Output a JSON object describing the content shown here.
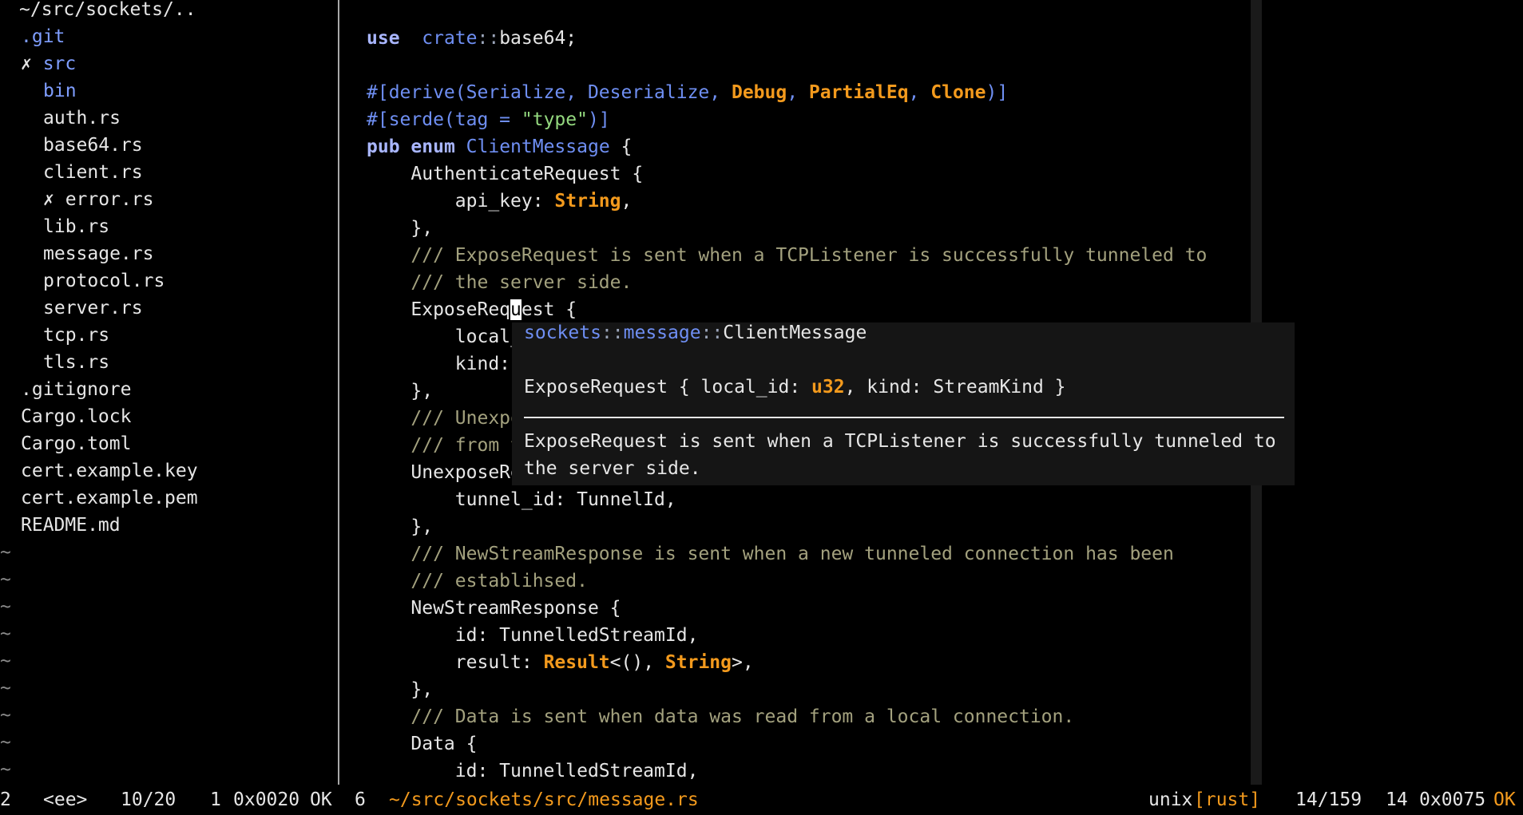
{
  "file_tree": {
    "header": "~/src/sockets/..",
    "items": [
      {
        "prefix": "",
        "name": ".git",
        "kind": "dir",
        "indent": 1
      },
      {
        "prefix": "✗ ",
        "name": "src",
        "kind": "dir",
        "indent": 1
      },
      {
        "prefix": "",
        "name": "bin",
        "kind": "dir",
        "indent": 2
      },
      {
        "prefix": "",
        "name": "auth.rs",
        "kind": "file",
        "indent": 2
      },
      {
        "prefix": "",
        "name": "base64.rs",
        "kind": "file",
        "indent": 2
      },
      {
        "prefix": "",
        "name": "client.rs",
        "kind": "file",
        "indent": 2
      },
      {
        "prefix": "✗ ",
        "name": "error.rs",
        "kind": "file",
        "indent": 2
      },
      {
        "prefix": "",
        "name": "lib.rs",
        "kind": "file",
        "indent": 2
      },
      {
        "prefix": "",
        "name": "message.rs",
        "kind": "file",
        "indent": 2
      },
      {
        "prefix": "",
        "name": "protocol.rs",
        "kind": "file",
        "indent": 2
      },
      {
        "prefix": "",
        "name": "server.rs",
        "kind": "file",
        "indent": 2
      },
      {
        "prefix": "",
        "name": "tcp.rs",
        "kind": "file",
        "indent": 2
      },
      {
        "prefix": "",
        "name": "tls.rs",
        "kind": "file",
        "indent": 2
      },
      {
        "prefix": "",
        "name": ".gitignore",
        "kind": "file",
        "indent": 0
      },
      {
        "prefix": "",
        "name": "Cargo.lock",
        "kind": "file",
        "indent": 0
      },
      {
        "prefix": "",
        "name": "Cargo.toml",
        "kind": "file",
        "indent": 0
      },
      {
        "prefix": "",
        "name": "cert.example.key",
        "kind": "file",
        "indent": 0
      },
      {
        "prefix": "",
        "name": "cert.example.pem",
        "kind": "file",
        "indent": 0
      },
      {
        "prefix": "",
        "name": "README.md",
        "kind": "file",
        "indent": 0
      }
    ],
    "empty_marker": "~"
  },
  "editor": {
    "lines": [
      [
        [
          "k",
          "use"
        ],
        [
          "",
          "  "
        ],
        [
          "b",
          "crate"
        ],
        [
          "p",
          "::"
        ],
        [
          "",
          "base64;"
        ]
      ],
      [],
      [
        [
          "b",
          "#[derive(Serialize, Deserialize, "
        ],
        [
          "t",
          "Debug"
        ],
        [
          "b",
          ", "
        ],
        [
          "t",
          "PartialEq"
        ],
        [
          "b",
          ", "
        ],
        [
          "t",
          "Clone"
        ],
        [
          "b",
          ")]"
        ]
      ],
      [
        [
          "b",
          "#[serde(tag = "
        ],
        [
          "s",
          "\"type\""
        ],
        [
          "b",
          ")]"
        ]
      ],
      [
        [
          "k",
          "pub"
        ],
        [
          "",
          " "
        ],
        [
          "k",
          "enum"
        ],
        [
          "",
          " "
        ],
        [
          "b",
          "ClientMessage"
        ],
        [
          "",
          " {"
        ]
      ],
      [
        [
          "",
          "    AuthenticateRequest {"
        ]
      ],
      [
        [
          "",
          "        api_key: "
        ],
        [
          "t",
          "String"
        ],
        [
          "",
          ","
        ]
      ],
      [
        [
          "",
          "    },"
        ]
      ],
      [
        [
          "c",
          "    /// ExposeRequest is sent when a TCPListener is successfully tunneled to"
        ]
      ],
      [
        [
          "c",
          "    /// the server side."
        ]
      ],
      [
        [
          "",
          "    ExposeReq"
        ],
        [
          "cursor",
          "u"
        ],
        [
          "",
          "est {"
        ]
      ],
      [
        [
          "",
          "        local_id: "
        ],
        [
          "t",
          "u32"
        ],
        [
          "",
          ","
        ]
      ],
      [
        [
          "",
          "        kind: StreamKind,"
        ]
      ],
      [
        [
          "",
          "    },"
        ]
      ],
      [
        [
          "c",
          "    /// UnexposeRequest is sent when a TCPListener is no longer accepting"
        ]
      ],
      [
        [
          "c",
          "    /// from the server side."
        ]
      ],
      [
        [
          "",
          "    UnexposeRequest {"
        ]
      ],
      [
        [
          "",
          "        tunnel_id: TunnelId,"
        ]
      ],
      [
        [
          "",
          "    },"
        ]
      ],
      [
        [
          "c",
          "    /// NewStreamResponse is sent when a new tunneled connection has been"
        ]
      ],
      [
        [
          "c",
          "    /// establihsed."
        ]
      ],
      [
        [
          "",
          "    NewStreamResponse {"
        ]
      ],
      [
        [
          "",
          "        id: TunnelledStreamId,"
        ]
      ],
      [
        [
          "",
          "        result: "
        ],
        [
          "t",
          "Result"
        ],
        [
          "",
          "<(), "
        ],
        [
          "t",
          "String"
        ],
        [
          "",
          ">,"
        ]
      ],
      [
        [
          "",
          "    },"
        ]
      ],
      [
        [
          "c",
          "    /// Data is sent when data was read from a local connection."
        ]
      ],
      [
        [
          "",
          "    Data {"
        ]
      ],
      [
        [
          "",
          "        id: TunnelledStreamId,"
        ]
      ]
    ]
  },
  "hover_popup": {
    "path_crate": "sockets",
    "path_sep1": "::",
    "path_module": "message",
    "path_sep2": "::",
    "path_type": "ClientMessage",
    "signature_a": "ExposeRequest { local_id: ",
    "signature_type": "u32",
    "signature_b": ", kind: StreamKind }",
    "doc_line1": "ExposeRequest is sent when a TCPListener is successfully tunneled to",
    "doc_line2": "the server side."
  },
  "statusbar": {
    "left_buffer": "2",
    "left_mode": "<ee>",
    "left_position": "10/20",
    "left_col": "1",
    "left_hex": "0x0020",
    "left_state": "OK",
    "right_buffer": "6",
    "right_path": "~/src/sockets/src/message.rs",
    "fileformat": "unix",
    "filetype": "[rust]",
    "right_position": "14/159",
    "right_col": "14",
    "right_hex": "0x0075",
    "right_state": "OK"
  },
  "colors": {
    "background": "#000000",
    "text": "#e6e6e6",
    "keyword": "#a9b6ff",
    "type": "#f39a1d",
    "ident": "#6f8ff3",
    "string": "#94d97f",
    "comment": "#a3a17e",
    "statusbar_path": "#f39a1d",
    "popup_bg": "#151515"
  }
}
